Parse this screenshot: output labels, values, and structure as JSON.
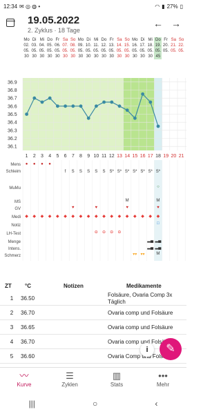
{
  "status": {
    "time": "12:34",
    "battery": "27%"
  },
  "header": {
    "title": "19.05.2022",
    "subtitle": "2. Zyklus · 18 Tage",
    "prev": "←",
    "next": "→"
  },
  "days": [
    {
      "wd": "Mo",
      "d": "02.",
      "m": "05.",
      "t": "30"
    },
    {
      "wd": "Di",
      "d": "03.",
      "m": "05.",
      "t": "30"
    },
    {
      "wd": "Mi",
      "d": "04.",
      "m": "05.",
      "t": "30"
    },
    {
      "wd": "Do",
      "d": "05.",
      "m": "05.",
      "t": "30"
    },
    {
      "wd": "Fr",
      "d": "06.",
      "m": "05.",
      "t": "30"
    },
    {
      "wd": "Sa",
      "d": "07.",
      "m": "05.",
      "t": "30"
    },
    {
      "wd": "So",
      "d": "08.",
      "m": "05.",
      "t": "30"
    },
    {
      "wd": "Mo",
      "d": "09.",
      "m": "05.",
      "t": "30"
    },
    {
      "wd": "Di",
      "d": "10.",
      "m": "05.",
      "t": "30"
    },
    {
      "wd": "Mi",
      "d": "11.",
      "m": "05.",
      "t": "30"
    },
    {
      "wd": "Do",
      "d": "12.",
      "m": "05.",
      "t": "30"
    },
    {
      "wd": "Fr",
      "d": "13.",
      "m": "05.",
      "t": "30"
    },
    {
      "wd": "Sa",
      "d": "14.",
      "m": "05.",
      "t": "30"
    },
    {
      "wd": "So",
      "d": "15.",
      "m": "05.",
      "t": "30"
    },
    {
      "wd": "Mo",
      "d": "16.",
      "m": "05.",
      "t": "30"
    },
    {
      "wd": "Di",
      "d": "17.",
      "m": "05.",
      "t": "30"
    },
    {
      "wd": "Mi",
      "d": "18.",
      "m": "05.",
      "t": "30"
    },
    {
      "wd": "Do",
      "d": "19.",
      "m": "05.",
      "t": "45"
    },
    {
      "wd": "Fr",
      "d": "20.",
      "m": "05.",
      "t": ""
    },
    {
      "wd": "Sa",
      "d": "21.",
      "m": "05.",
      "t": ""
    },
    {
      "wd": "So",
      "d": "22.",
      "m": "05.",
      "t": ""
    }
  ],
  "chart_data": {
    "type": "line",
    "y_ticks": [
      "36.9",
      "36.8",
      "36.7",
      "36.6",
      "36.5",
      "36.4",
      "36.3",
      "36.2",
      "36.1"
    ],
    "ylim": [
      36.05,
      36.95
    ],
    "x": [
      1,
      2,
      3,
      4,
      5,
      6,
      7,
      8,
      9,
      10,
      11,
      12,
      13,
      14,
      15,
      16,
      17,
      18
    ],
    "values": [
      36.5,
      36.7,
      36.65,
      36.7,
      36.6,
      36.6,
      36.6,
      36.6,
      36.45,
      36.6,
      36.65,
      36.65,
      36.6,
      36.55,
      36.45,
      36.75,
      36.65,
      36.35
    ],
    "cycle_days": [
      "1",
      "2",
      "3",
      "4",
      "5",
      "6",
      "7",
      "8",
      "9",
      "10",
      "11",
      "12",
      "13",
      "14",
      "15",
      "16",
      "17",
      "18",
      "19",
      "20",
      "21"
    ]
  },
  "row_labels": [
    "Mens",
    "Schleim",
    "MuMu",
    "MS",
    "GV",
    "Medi",
    "Notiz",
    "LH-Test",
    "Menge",
    "Intens.",
    "Schmerz"
  ],
  "mucus": [
    "",
    "",
    "",
    "",
    "",
    "f",
    "S",
    "S",
    "S",
    "S",
    "S",
    "S*",
    "S*",
    "S*",
    "S*",
    "S*",
    "S*",
    "S*"
  ],
  "ms_mark": "M",
  "table": {
    "headers": {
      "zt": "ZT",
      "temp": "°C",
      "notes": "Notizen",
      "meds": "Medikamente"
    },
    "rows": [
      {
        "zt": "1",
        "temp": "36.50",
        "meds": "Folsäure, Ovaria Comp 3x Täglich"
      },
      {
        "zt": "2",
        "temp": "36.70",
        "meds": "Ovaria comp und Folsäure"
      },
      {
        "zt": "3",
        "temp": "36.65",
        "meds": "Ovaria comp und Folsäure"
      },
      {
        "zt": "4",
        "temp": "36.70",
        "meds": "Ovaria comp und Folsäure"
      },
      {
        "zt": "5",
        "temp": "36.60",
        "meds": "Ovaria Comp und Folsäure"
      },
      {
        "zt": "6",
        "temp": "36.60",
        "meds": "Ovaria Comp und Folsäure"
      }
    ]
  },
  "fab": {
    "info": "i",
    "edit": "✎"
  },
  "bottom": {
    "kurve": "Kurve",
    "zyklen": "Zyklen",
    "stats": "Stats",
    "mehr": "Mehr"
  },
  "colors": {
    "accent": "#c2185b",
    "green": "#c5e1a5",
    "line": "#4a90a4"
  }
}
